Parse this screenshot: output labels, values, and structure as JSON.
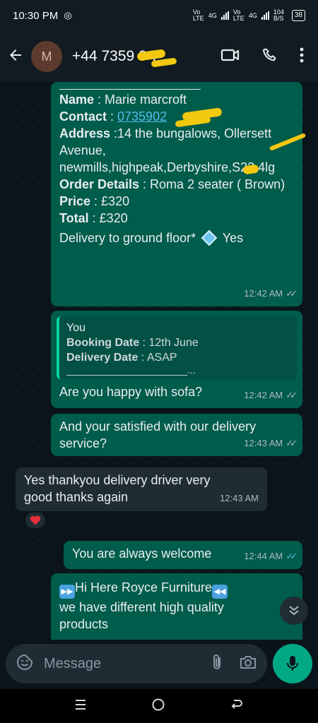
{
  "status_bar": {
    "time": "10:30 PM",
    "net_1": "Vo LTE",
    "net_2": "4G",
    "net_3": "Vo LTE",
    "net_4": "4G",
    "speed": "104 B/S",
    "battery": "38"
  },
  "header": {
    "avatar_letter": "M",
    "contact_name": "+44 7359 0 7"
  },
  "messages": {
    "order": {
      "name_label": "Name",
      "name_value": " : Marie marcroft",
      "contact_label": "Contact",
      "contact_value": "0735902",
      "address_label": "Address",
      "address_value": " :14 the bungalows, Ollersett Avenue, newmills,highpeak,Derbyshire,S22 4lg",
      "order_label": "Order Details",
      "order_value": " :  Roma 2 seater ( Brown)",
      "price_label": "Price",
      "price_value": " : £320",
      "total_label": "Total",
      "total_value": " : £320",
      "delivery_text": "Delivery to ground floor*",
      "delivery_yes": " Yes",
      "time": "12:42 AM"
    },
    "reply": {
      "quote_author": "You",
      "booking_label": "Booking Date",
      "booking_value": " : 12th June",
      "delivery_label": "Delivery Date",
      "delivery_value": " : ASAP",
      "quote_line": "______________________...",
      "text": "Are you happy with sofa?",
      "time": "12:42 AM"
    },
    "satisfied": {
      "text": "And your satisfied with our delivery service?",
      "time": "12:43 AM"
    },
    "incoming": {
      "text": "Yes thankyou delivery driver very good thanks  again",
      "time": "12:43 AM",
      "reaction": "❤️"
    },
    "welcome": {
      "text": "You are always welcome",
      "time": "12:44 AM"
    },
    "promo": {
      "line1": "Hi Here Royce Furniture",
      "line2": " we have different high quality products"
    }
  },
  "input": {
    "placeholder": "Message"
  },
  "icons": {
    "back": "arrow-left-icon",
    "video": "video-call-icon",
    "call": "phone-icon",
    "menu": "more-vert-icon",
    "emoji": "sticker-icon",
    "attach": "paperclip-icon",
    "camera": "camera-icon",
    "mic": "mic-icon",
    "scroll": "chevron-double-down-icon"
  },
  "colors": {
    "outgoing_bubble": "#005c4b",
    "incoming_bubble": "#202c33",
    "accent": "#00a884",
    "read_tick": "#53bdeb"
  }
}
